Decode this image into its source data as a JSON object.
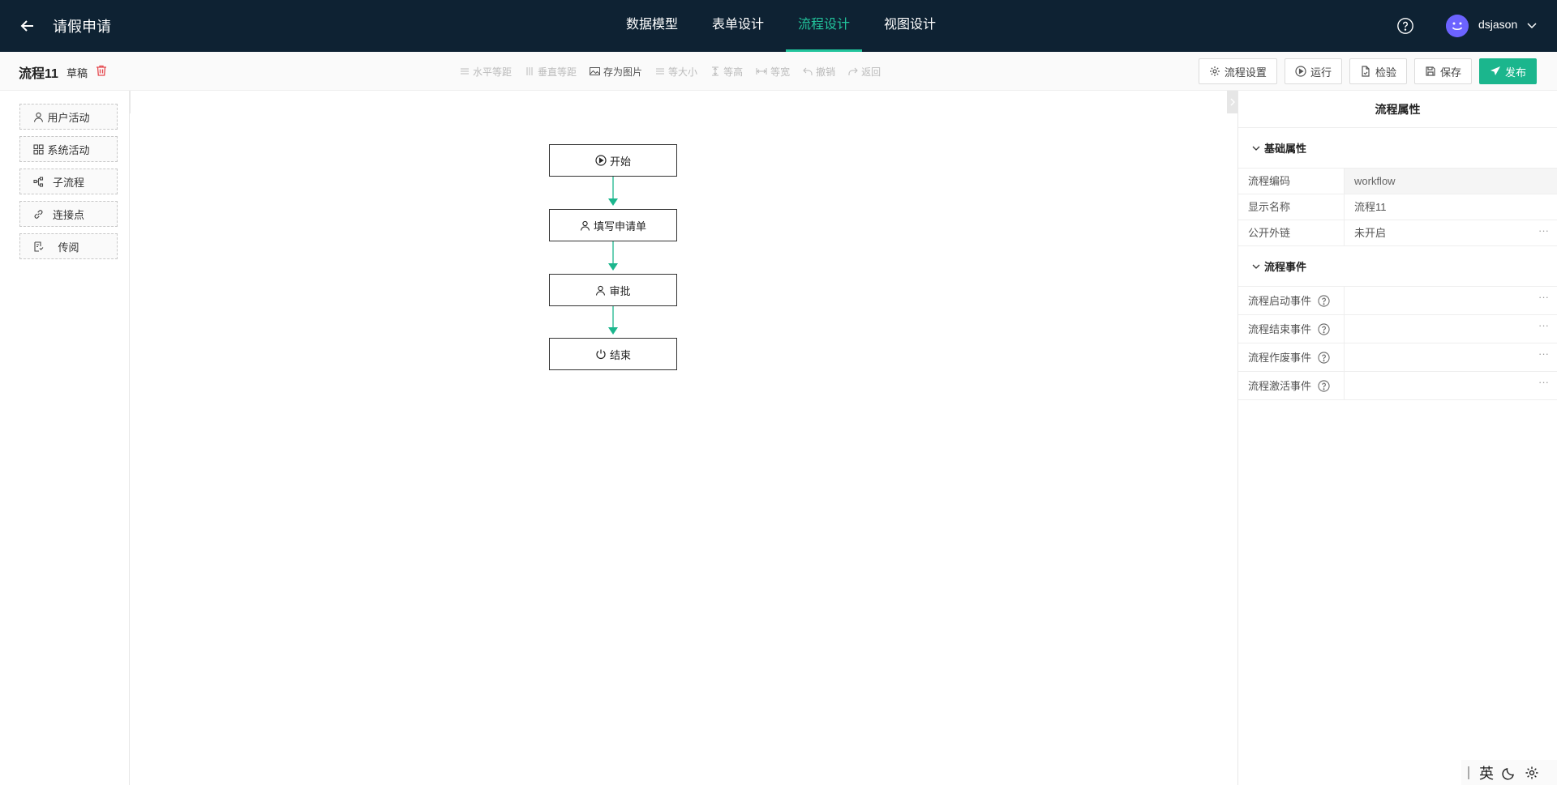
{
  "header": {
    "title": "请假申请",
    "tabs": [
      {
        "label": "数据模型",
        "active": false
      },
      {
        "label": "表单设计",
        "active": false
      },
      {
        "label": "流程设计",
        "active": true
      },
      {
        "label": "视图设计",
        "active": false
      }
    ],
    "username": "dsjason",
    "accent_color": "#22c49c",
    "bg_color": "#0e2233"
  },
  "toolbar": {
    "flow_name": "流程11",
    "status_tag": "草稿",
    "tools": [
      {
        "label": "水平等距",
        "icon": "align-horizontal-icon",
        "enabled": false
      },
      {
        "label": "垂直等距",
        "icon": "align-vertical-icon",
        "enabled": false
      },
      {
        "label": "存为图片",
        "icon": "image-icon",
        "enabled": true
      },
      {
        "label": "等大小",
        "icon": "same-size-icon",
        "enabled": false
      },
      {
        "label": "等高",
        "icon": "same-height-icon",
        "enabled": false
      },
      {
        "label": "等宽",
        "icon": "same-width-icon",
        "enabled": false
      },
      {
        "label": "撤销",
        "icon": "undo-icon",
        "enabled": false
      },
      {
        "label": "返回",
        "icon": "redo-icon",
        "enabled": false
      }
    ],
    "actions": {
      "settings": "流程设置",
      "run": "运行",
      "check": "检验",
      "save": "保存",
      "publish": "发布"
    }
  },
  "palette": {
    "items": [
      {
        "label": "用户活动",
        "icon": "user-icon"
      },
      {
        "label": "系统活动",
        "icon": "grid-icon"
      },
      {
        "label": "子流程",
        "icon": "subflow-icon"
      },
      {
        "label": "连接点",
        "icon": "link-icon"
      },
      {
        "label": "传阅",
        "icon": "circulate-icon"
      }
    ]
  },
  "canvas": {
    "nodes": [
      {
        "label": "开始",
        "icon": "play-icon"
      },
      {
        "label": "填写申请单",
        "icon": "user-icon"
      },
      {
        "label": "审批",
        "icon": "user-icon"
      },
      {
        "label": "结束",
        "icon": "power-icon"
      }
    ],
    "edge_color": "#1bb68d"
  },
  "properties": {
    "title": "流程属性",
    "basic_section": "基础属性",
    "basic": {
      "code_label": "流程编码",
      "code_value": "workflow",
      "name_label": "显示名称",
      "name_value": "流程11",
      "link_label": "公开外链",
      "link_value": "未开启"
    },
    "events_section": "流程事件",
    "events": [
      {
        "label": "流程启动事件"
      },
      {
        "label": "流程结束事件"
      },
      {
        "label": "流程作废事件"
      },
      {
        "label": "流程激活事件"
      }
    ],
    "more": "···"
  },
  "tray": {
    "ime": "英"
  }
}
